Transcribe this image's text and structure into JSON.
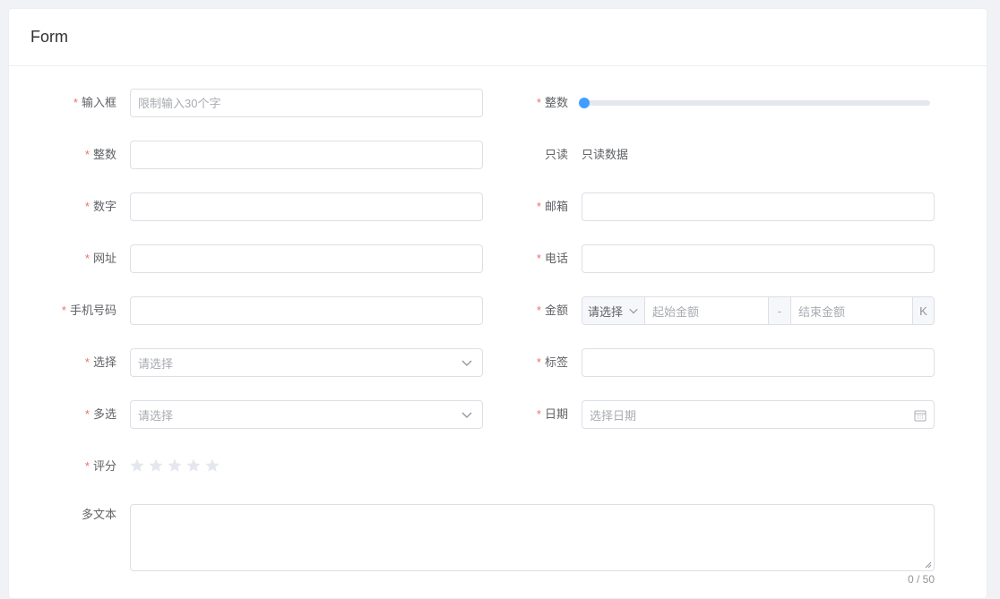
{
  "card": {
    "title": "Form"
  },
  "form": {
    "required_mark": "*",
    "left": [
      {
        "label": "输入框",
        "required": true,
        "placeholder": "限制输入30个字",
        "value": ""
      },
      {
        "label": "整数",
        "required": true,
        "placeholder": "",
        "value": ""
      },
      {
        "label": "数字",
        "required": true,
        "placeholder": "",
        "value": ""
      },
      {
        "label": "网址",
        "required": true,
        "placeholder": "",
        "value": ""
      },
      {
        "label": "手机号码",
        "required": true,
        "placeholder": "",
        "value": ""
      },
      {
        "label": "选择",
        "required": true,
        "placeholder": "请选择",
        "icon": "chevron-down-icon"
      },
      {
        "label": "多选",
        "required": true,
        "placeholder": "请选择",
        "icon": "chevron-down-icon"
      },
      {
        "label": "评分",
        "required": true,
        "stars": 5,
        "rating": 0
      }
    ],
    "right": [
      {
        "label": "整数",
        "required": true,
        "slider_value_fraction": 0
      },
      {
        "label": "只读",
        "required": false,
        "value": "只读数据"
      },
      {
        "label": "邮箱",
        "required": true,
        "value": ""
      },
      {
        "label": "电话",
        "required": true,
        "value": ""
      },
      {
        "label": "金额",
        "required": true,
        "prefix": "请选择",
        "start_placeholder": "起始金额",
        "separator": "-",
        "end_placeholder": "结束金额",
        "suffix": "K"
      },
      {
        "label": "标签",
        "required": true,
        "value": ""
      },
      {
        "label": "日期",
        "required": true,
        "placeholder": "选择日期",
        "icon": "calendar-icon"
      }
    ],
    "textarea": {
      "label": "多文本",
      "required": false,
      "value": "",
      "count": "0 / 50"
    }
  },
  "colors": {
    "required": "#f56c6c",
    "accent": "#409eff",
    "border": "#dcdfe6",
    "star_empty": "#e4e7ed"
  }
}
